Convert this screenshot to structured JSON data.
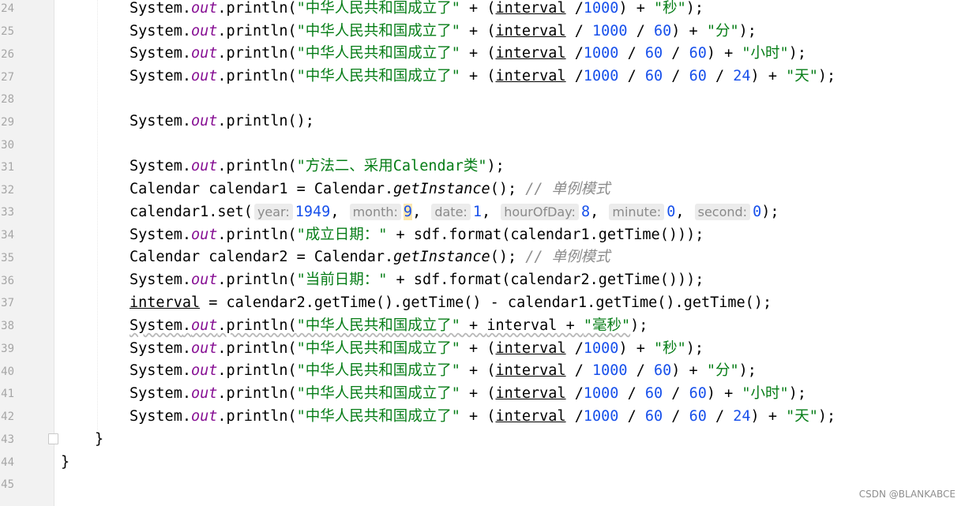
{
  "editor": {
    "line_numbers": [
      "24",
      "25",
      "26",
      "27",
      "28",
      "29",
      "30",
      "31",
      "32",
      "33",
      "34",
      "35",
      "36",
      "37",
      "38",
      "39",
      "40",
      "41",
      "42",
      "43",
      "44",
      "45"
    ],
    "tokens": {
      "system": "System",
      "dot": ".",
      "out": "out",
      "println_open": "println(",
      "msg_prefix": "\"中华人民共和国成立了\"",
      "plus_paren": " + (",
      "interval": "interval",
      "unit_sec": "\"秒\"",
      "unit_min": "\"分\"",
      "unit_hour": "\"小时\"",
      "unit_day": "\"天\"",
      "unit_ms": "\"毫秒\"",
      "n1000": "1000",
      "n60": "60",
      "n24": "24",
      "method2": "\"方法二、采用Calendar类\"",
      "calendar_type": "Calendar",
      "calendar1": "calendar1",
      "calendar2": "calendar2",
      "get_instance": "getInstance",
      "comment_singleton": "// 单例模式",
      "set_call": "calendar1.set(",
      "hint_year": "year:",
      "hint_month": "month:",
      "hint_date": "date:",
      "hint_hour": "hourOfDay:",
      "hint_minute": "minute:",
      "hint_second": "second:",
      "v_year": "1949",
      "v_month": "9",
      "v_date": "1",
      "v_hour": "8",
      "v_minute": "0",
      "v_second": "0",
      "found_date": "\"成立日期：\"",
      "current_date": "\"当前日期：\"",
      "format_c1": " + sdf.format(calendar1.getTime()));",
      "format_c2": " + sdf.format(calendar2.getTime()));",
      "interval_assign": " = calendar2.getTime().getTime() - calendar1.getTime().getTime();",
      "println_empty": "println();",
      "close_brace": "}"
    }
  },
  "watermark": "CSDN @BLANKABCE"
}
